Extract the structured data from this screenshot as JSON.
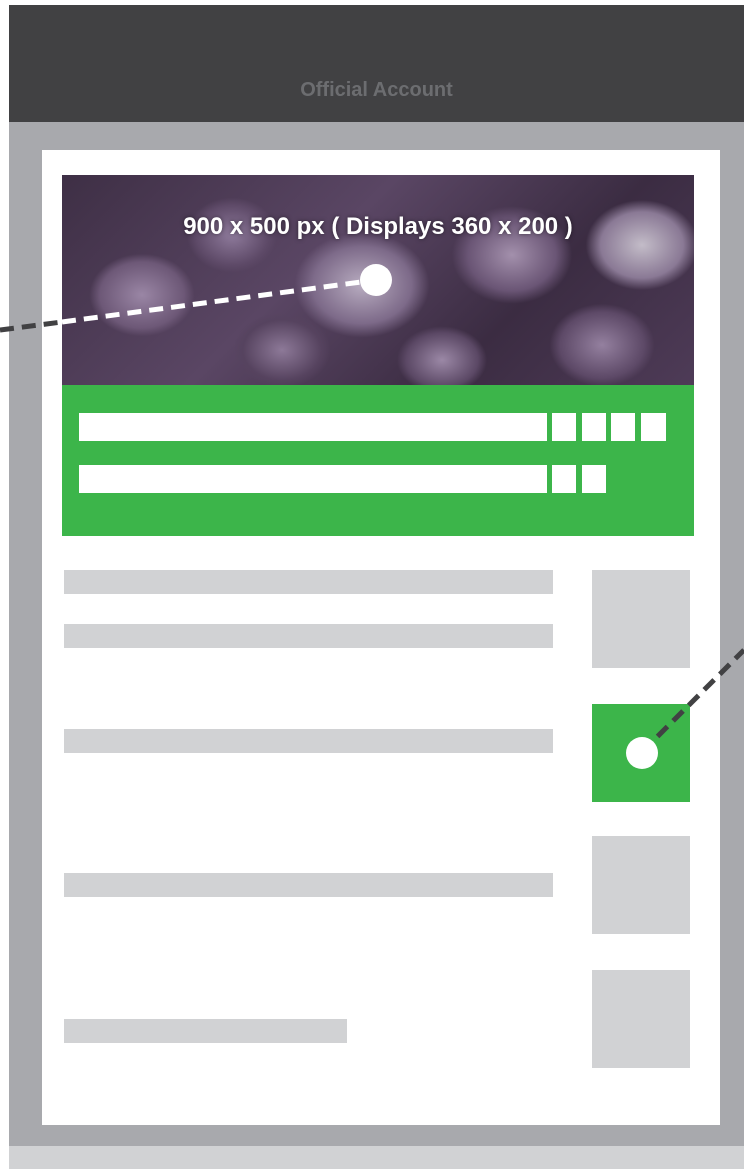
{
  "header": {
    "title": "Official Account"
  },
  "hero": {
    "size_label": "900 x 500 px ( Displays 360 x 200 )"
  },
  "colors": {
    "header": "#414143",
    "frame": "#a8a9ad",
    "accent_green": "#3cb54a",
    "placeholder_gray": "#d1d2d4",
    "header_text": "#6c6d70"
  }
}
